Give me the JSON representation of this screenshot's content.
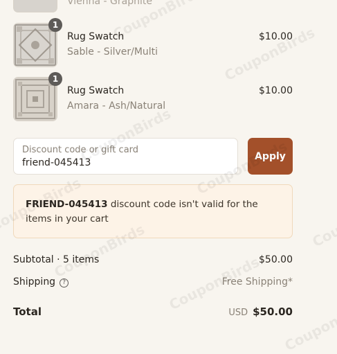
{
  "cart_items": [
    {
      "name": "Vienna",
      "variant": "Vienna - Graphite",
      "qty": "",
      "price": ""
    },
    {
      "name": "Rug Swatch",
      "variant": "Sable - Silver/Multi",
      "qty": "1",
      "price": "$10.00"
    },
    {
      "name": "Rug Swatch",
      "variant": "Amara - Ash/Natural",
      "qty": "1",
      "price": "$10.00"
    }
  ],
  "discount": {
    "label": "Discount code or gift card",
    "value": "friend-045413",
    "apply_label": "Apply"
  },
  "error": {
    "code": "FRIEND-045413",
    "message": " discount code isn't valid for the items in your cart"
  },
  "summary": {
    "subtotal_label": "Subtotal · 5 items",
    "subtotal_value": "$50.00",
    "shipping_label": "Shipping",
    "shipping_value": "Free Shipping*",
    "total_label": "Total",
    "currency": "USD",
    "total_value": "$50.00"
  },
  "watermark_text": "CouponBirds",
  "colors": {
    "accent": "#a3502a",
    "error_bg": "#fdf3e7",
    "page_bg": "#f8f5ef"
  }
}
